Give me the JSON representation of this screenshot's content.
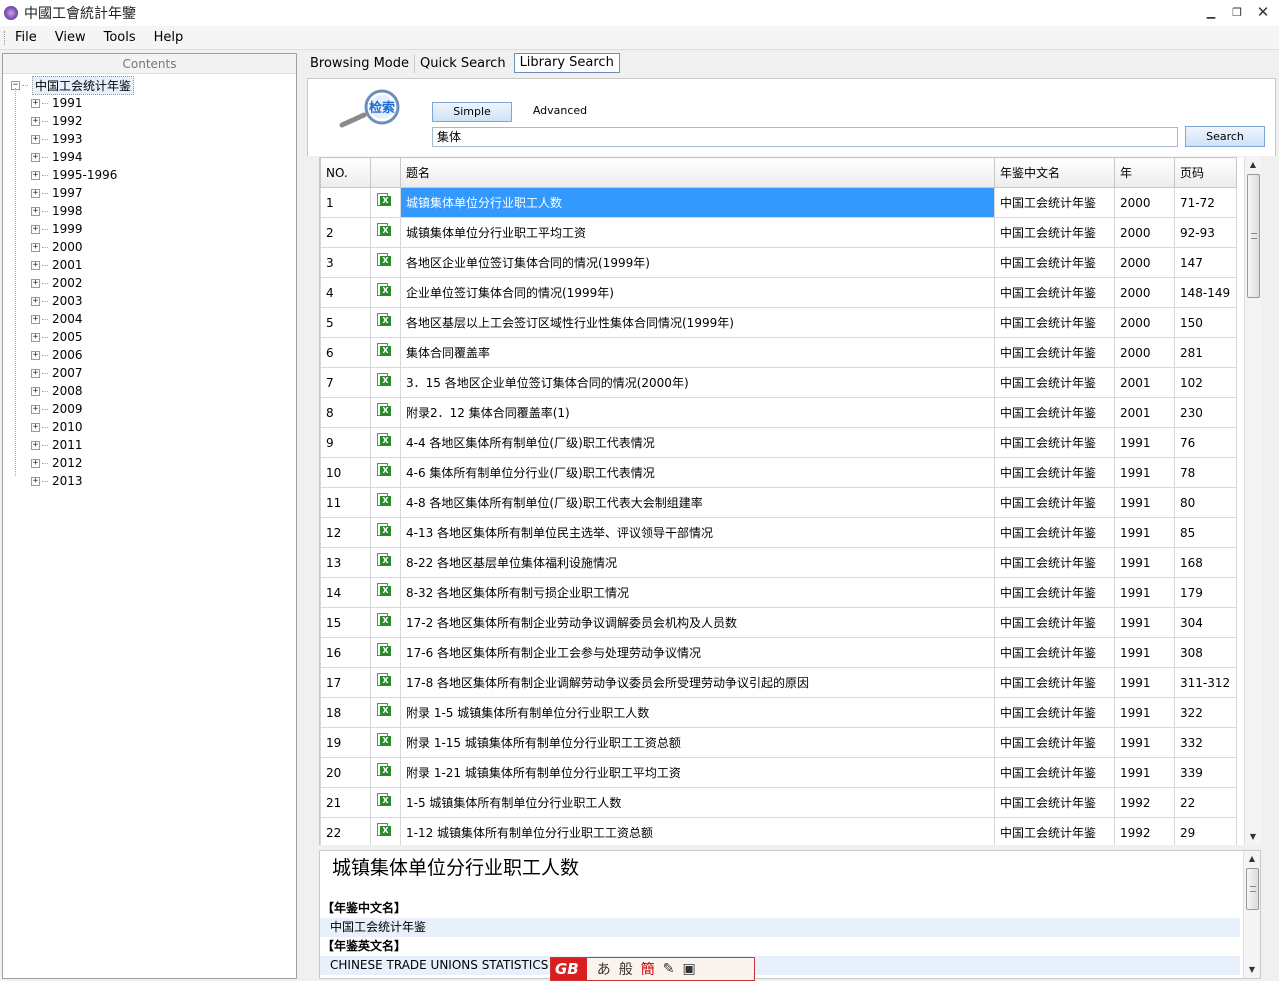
{
  "window": {
    "title": "中國工會統計年鑒",
    "minimize": "▁",
    "maximize": "❐",
    "close": "✕"
  },
  "menu": [
    "File",
    "View",
    "Tools",
    "Help"
  ],
  "left_panel": {
    "header": "Contents",
    "root": "中国工会统计年鉴",
    "years": [
      "1991",
      "1992",
      "1993",
      "1994",
      "1995-1996",
      "1997",
      "1998",
      "1999",
      "2000",
      "2001",
      "2002",
      "2003",
      "2004",
      "2005",
      "2006",
      "2007",
      "2008",
      "2009",
      "2010",
      "2011",
      "2012",
      "2013"
    ]
  },
  "tabs": [
    "Browsing Mode",
    "Quick Search",
    "Library Search"
  ],
  "active_tab": "Library Search",
  "search": {
    "logo_text": "检索",
    "simple_label": "Simple",
    "advanced_label": "Advanced",
    "query": "集体",
    "search_button": "Search"
  },
  "table": {
    "columns": [
      "NO.",
      "",
      "题名",
      "年鉴中文名",
      "年",
      "页码"
    ],
    "rows": [
      [
        "1",
        "城镇集体单位分行业职工人数",
        "中国工会统计年鉴",
        "2000",
        "71-72"
      ],
      [
        "2",
        "城镇集体单位分行业职工平均工资",
        "中国工会统计年鉴",
        "2000",
        "92-93"
      ],
      [
        "3",
        "各地区企业单位签订集体合同的情况(1999年)",
        "中国工会统计年鉴",
        "2000",
        "147"
      ],
      [
        "4",
        "企业单位签订集体合同的情况(1999年)",
        "中国工会统计年鉴",
        "2000",
        "148-149"
      ],
      [
        "5",
        "各地区基层以上工会签订区域性行业性集体合同情况(1999年)",
        "中国工会统计年鉴",
        "2000",
        "150"
      ],
      [
        "6",
        "集体合同覆盖率",
        "中国工会统计年鉴",
        "2000",
        "281"
      ],
      [
        "7",
        "3．15 各地区企业单位签订集体合同的情况(2000年)",
        "中国工会统计年鉴",
        "2001",
        "102"
      ],
      [
        "8",
        "附录2．12 集体合同覆盖率(1)",
        "中国工会统计年鉴",
        "2001",
        "230"
      ],
      [
        "9",
        "4-4 各地区集体所有制单位(厂级)职工代表情况",
        "中国工会统计年鉴",
        "1991",
        "76"
      ],
      [
        "10",
        "4-6 集体所有制单位分行业(厂级)职工代表情况",
        "中国工会统计年鉴",
        "1991",
        "78"
      ],
      [
        "11",
        "4-8 各地区集体所有制单位(厂级)职工代表大会制组建率",
        "中国工会统计年鉴",
        "1991",
        "80"
      ],
      [
        "12",
        "4-13 各地区集体所有制单位民主选举、评议领导干部情况",
        "中国工会统计年鉴",
        "1991",
        "85"
      ],
      [
        "13",
        "8-22 各地区基层单位集体福利设施情况",
        "中国工会统计年鉴",
        "1991",
        "168"
      ],
      [
        "14",
        "8-32 各地区集体所有制亏损企业职工情况",
        "中国工会统计年鉴",
        "1991",
        "179"
      ],
      [
        "15",
        "17-2 各地区集体所有制企业劳动争议调解委员会机构及人员数",
        "中国工会统计年鉴",
        "1991",
        "304"
      ],
      [
        "16",
        "17-6 各地区集体所有制企业工会参与处理劳动争议情况",
        "中国工会统计年鉴",
        "1991",
        "308"
      ],
      [
        "17",
        "17-8 各地区集体所有制企业调解劳动争议委员会所受理劳动争议引起的原因",
        "中国工会统计年鉴",
        "1991",
        "311-312"
      ],
      [
        "18",
        "附录 1-5 城镇集体所有制单位分行业职工人数",
        "中国工会统计年鉴",
        "1991",
        "322"
      ],
      [
        "19",
        "附录 1-15 城镇集体所有制单位分行业职工工资总额",
        "中国工会统计年鉴",
        "1991",
        "332"
      ],
      [
        "20",
        "附录 1-21 城镇集体所有制单位分行业职工平均工资",
        "中国工会统计年鉴",
        "1991",
        "339"
      ],
      [
        "21",
        "1-5 城镇集体所有制单位分行业职工人数",
        "中国工会统计年鉴",
        "1992",
        "22"
      ],
      [
        "22",
        "1-12 城镇集体所有制单位分行业职工工资总额",
        "中国工会统计年鉴",
        "1992",
        "29"
      ]
    ]
  },
  "detail": {
    "title": "城镇集体单位分行业职工人数",
    "fields": [
      {
        "label": "【年鉴中文名】",
        "value": "中国工会统计年鉴"
      },
      {
        "label": "【年鉴英文名】",
        "value": "CHINESE TRADE UNIONS STATISTICS YEARBOOK"
      }
    ]
  },
  "ime": {
    "logo": "GB",
    "items": [
      "あ",
      "般",
      "簡"
    ]
  }
}
